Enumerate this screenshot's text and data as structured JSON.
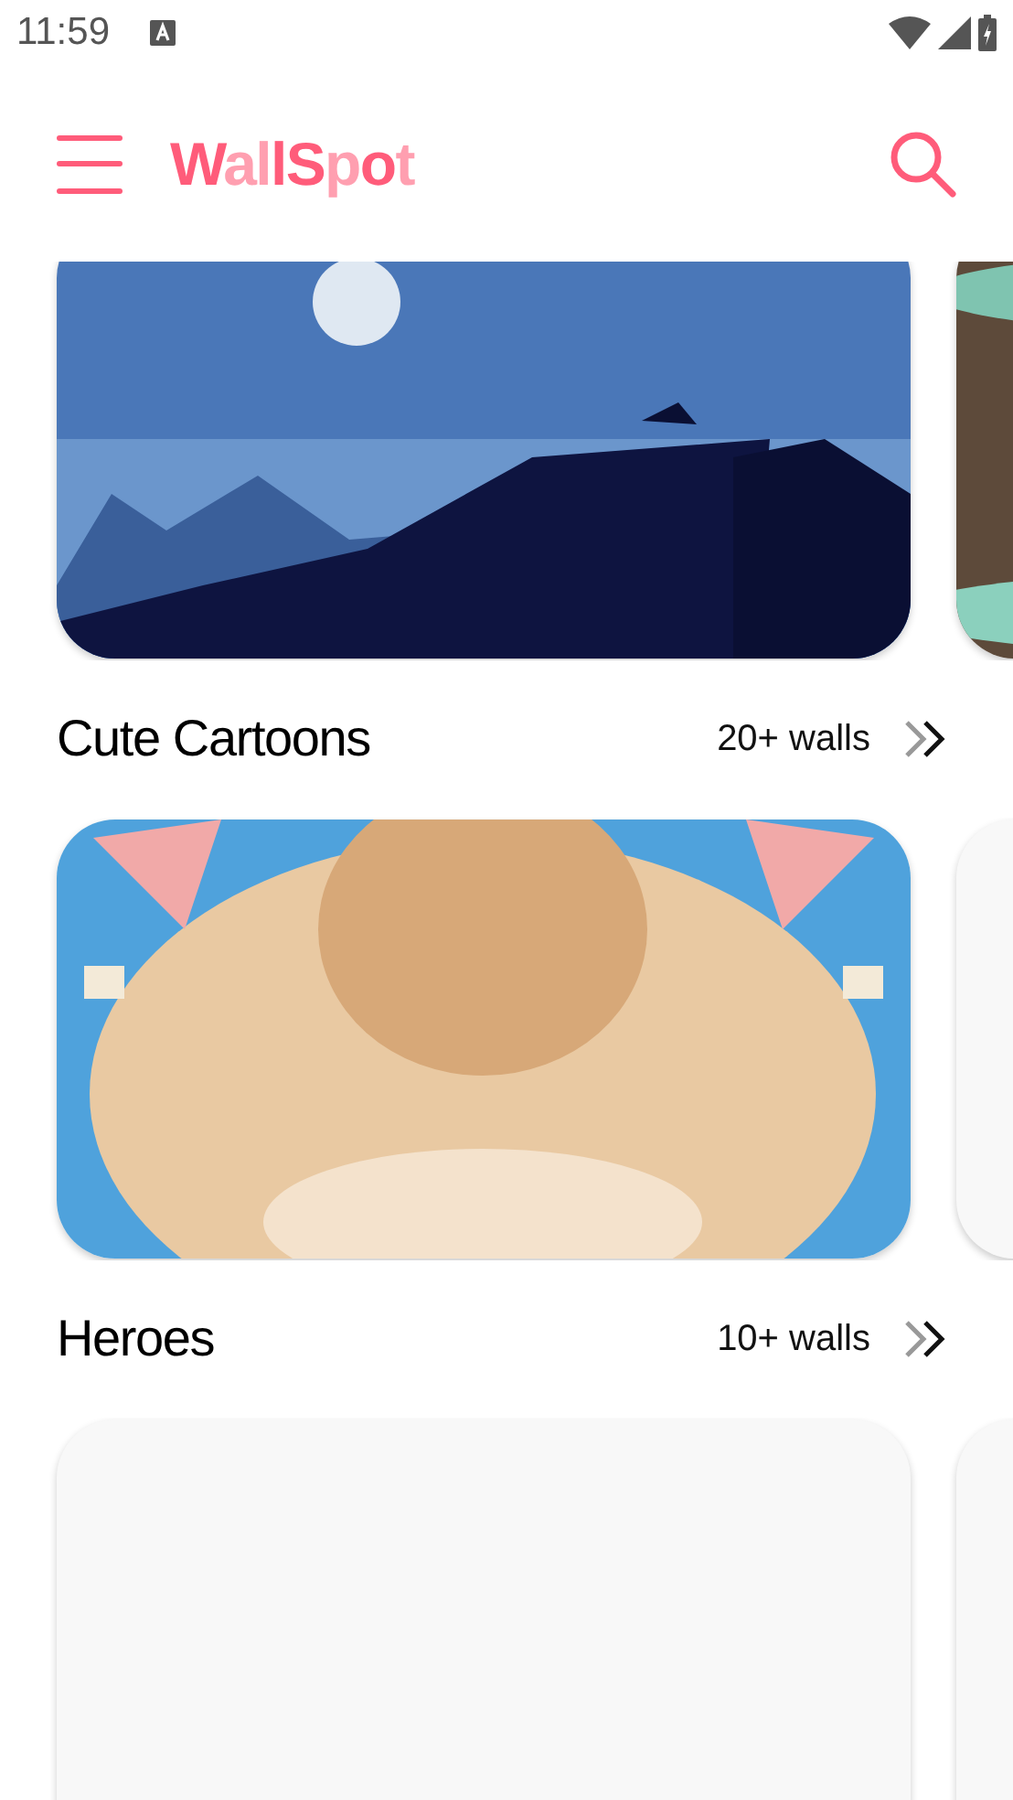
{
  "status_bar": {
    "time": "11:59"
  },
  "app_bar": {
    "logo": [
      {
        "text": "W",
        "color": "#ff5c7a"
      },
      {
        "text": "a",
        "color": "#ff9fb0"
      },
      {
        "text": "l",
        "color": "#ff9fb0"
      },
      {
        "text": "l",
        "color": "#ff5c7a"
      },
      {
        "text": "S",
        "color": "#ff5c7a"
      },
      {
        "text": "p",
        "color": "#ff9fb0"
      },
      {
        "text": "o",
        "color": "#ff5c7a"
      },
      {
        "text": "t",
        "color": "#ff9fb0"
      }
    ]
  },
  "sections": [
    {
      "cards": [
        {
          "kind": "picture"
        },
        {
          "kind": "picture"
        }
      ]
    },
    {
      "title": "Cute Cartoons",
      "count": "20+ walls",
      "cards": [
        {
          "kind": "picture"
        },
        {
          "kind": "placeholder"
        }
      ]
    },
    {
      "title": "Heroes",
      "count": "10+ walls",
      "cards": [
        {
          "kind": "placeholder"
        },
        {
          "kind": "placeholder"
        }
      ]
    }
  ]
}
